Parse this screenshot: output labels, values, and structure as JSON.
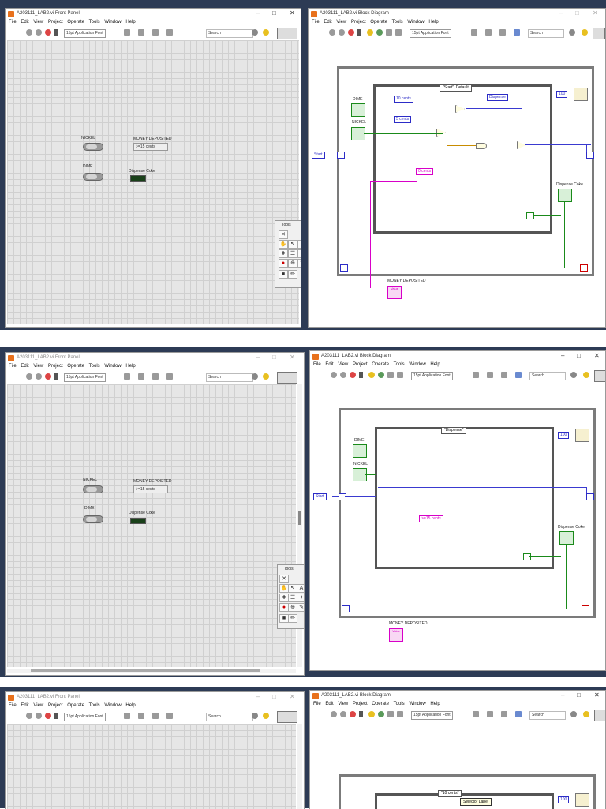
{
  "fp_title": "A203111_LAB2.vi Front Panel",
  "bd_title": "A203111_LAB2.vi Block Diagram",
  "fp_menu": [
    "File",
    "Edit",
    "View",
    "Project",
    "Operate",
    "Tools",
    "Window",
    "Help"
  ],
  "bd_menu": [
    "File",
    "Edit",
    "View",
    "Project",
    "Operate",
    "Tools",
    "Window",
    "Help"
  ],
  "font_selector": "15pt Application Font",
  "search_placeholder": "Search",
  "controls": {
    "nickel": "NICKEL",
    "dime": "DIME",
    "money": "MONEY DEPOSITED",
    "dispense": "Dispense Coke"
  },
  "money_values": [
    ">=15 cents",
    ">=15 cents"
  ],
  "tools_title": "Tools",
  "diagram": {
    "case1": "\"Start\", Default",
    "case2": "\"Dispense\"",
    "case3": "\"10 cents\"",
    "const_10": "10 cents",
    "const_5": "5 cents",
    "const_dispense": "Dispense",
    "const_0": "0 cents",
    "const_15": ">=15 cents",
    "const_start": "Start",
    "const_100": "100",
    "tooltip": "Selector Label",
    "dime": "DIME",
    "nickel": "NICKEL",
    "dispense": "Dispense Coke",
    "money": "MONEY DEPOSITED",
    "fmt": "Value"
  },
  "colors": {
    "accent": "#e8711c",
    "wire_enum": "#3a3ad0",
    "wire_bool": "#1a8a1a",
    "wire_string": "#d800c8"
  }
}
